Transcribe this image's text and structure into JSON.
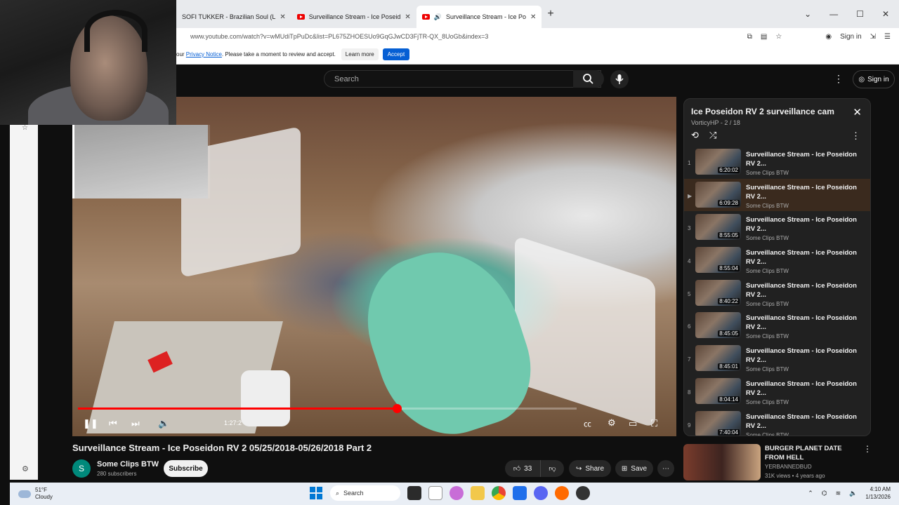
{
  "browser": {
    "tabs": [
      {
        "label": "SOFI TUKKER - Brazilian Soul (L",
        "active": false
      },
      {
        "label": "Surveillance Stream - Ice Poseid",
        "active": false
      },
      {
        "label": "Surveillance Stream - Ice Po",
        "active": true
      }
    ],
    "url": "www.youtube.com/watch?v=wMUdiTpPuDc&list=PL675ZHOESUo9GqGJwCD3FjTR-QX_8UoGb&index=3",
    "sign_in": "Sign in"
  },
  "consent": {
    "prefix": "our",
    "link": "Privacy Notice",
    "suffix": ". Please take a moment to review and accept.",
    "learn_more": "Learn more",
    "accept": "Accept"
  },
  "yt_header": {
    "search_placeholder": "Search",
    "sign_in": "Sign in"
  },
  "player": {
    "progress": 0.64,
    "time": "1:27:2"
  },
  "video": {
    "title": "Surveillance Stream - Ice Poseidon RV 2 05/25/2018-05/26/2018 Part 2",
    "channel_initial": "S",
    "channel": "Some Clips BTW",
    "subscribers": "280 subscribers",
    "subscribe": "Subscribe",
    "likes": "33",
    "share": "Share",
    "save": "Save"
  },
  "playlist": {
    "title": "Ice Poseidon RV 2 surveillance cam",
    "subtitle": "VorticyHP - 2 / 18",
    "items": [
      {
        "num": "1",
        "title": "Surveillance Stream - Ice Poseidon RV 2...",
        "channel": "Some Clips BTW",
        "duration": "6:20:02",
        "current": false
      },
      {
        "num": "▶",
        "title": "Surveillance Stream - Ice Poseidon RV 2...",
        "channel": "Some Clips BTW",
        "duration": "6:09:28",
        "current": true
      },
      {
        "num": "3",
        "title": "Surveillance Stream - Ice Poseidon RV 2...",
        "channel": "Some Clips BTW",
        "duration": "8:55:05",
        "current": false
      },
      {
        "num": "4",
        "title": "Surveillance Stream - Ice Poseidon RV 2...",
        "channel": "Some Clips BTW",
        "duration": "8:55:04",
        "current": false
      },
      {
        "num": "5",
        "title": "Surveillance Stream - Ice Poseidon RV 2...",
        "channel": "Some Clips BTW",
        "duration": "8:40:22",
        "current": false
      },
      {
        "num": "6",
        "title": "Surveillance Stream - Ice Poseidon RV 2...",
        "channel": "Some Clips BTW",
        "duration": "8:45:05",
        "current": false
      },
      {
        "num": "7",
        "title": "Surveillance Stream - Ice Poseidon RV 2...",
        "channel": "Some Clips BTW",
        "duration": "8:45:01",
        "current": false
      },
      {
        "num": "8",
        "title": "Surveillance Stream - Ice Poseidon RV 2...",
        "channel": "Some Clips BTW",
        "duration": "8:04:14",
        "current": false
      },
      {
        "num": "9",
        "title": "Surveillance Stream - Ice Poseidon RV 2...",
        "channel": "Some Clips BTW",
        "duration": "7:40:04",
        "current": false
      }
    ]
  },
  "related": {
    "title": "BURGER PLANET DATE FROM HELL",
    "channel": "YERBANNEDBUD",
    "meta": "31K views • 4 years ago"
  },
  "taskbar": {
    "temp": "51°F",
    "condition": "Cloudy",
    "search": "Search",
    "time": "4:10 AM",
    "date": "1/13/2026"
  },
  "colors": {
    "accent_red": "#ff0000",
    "accept_blue": "#065fd4"
  }
}
